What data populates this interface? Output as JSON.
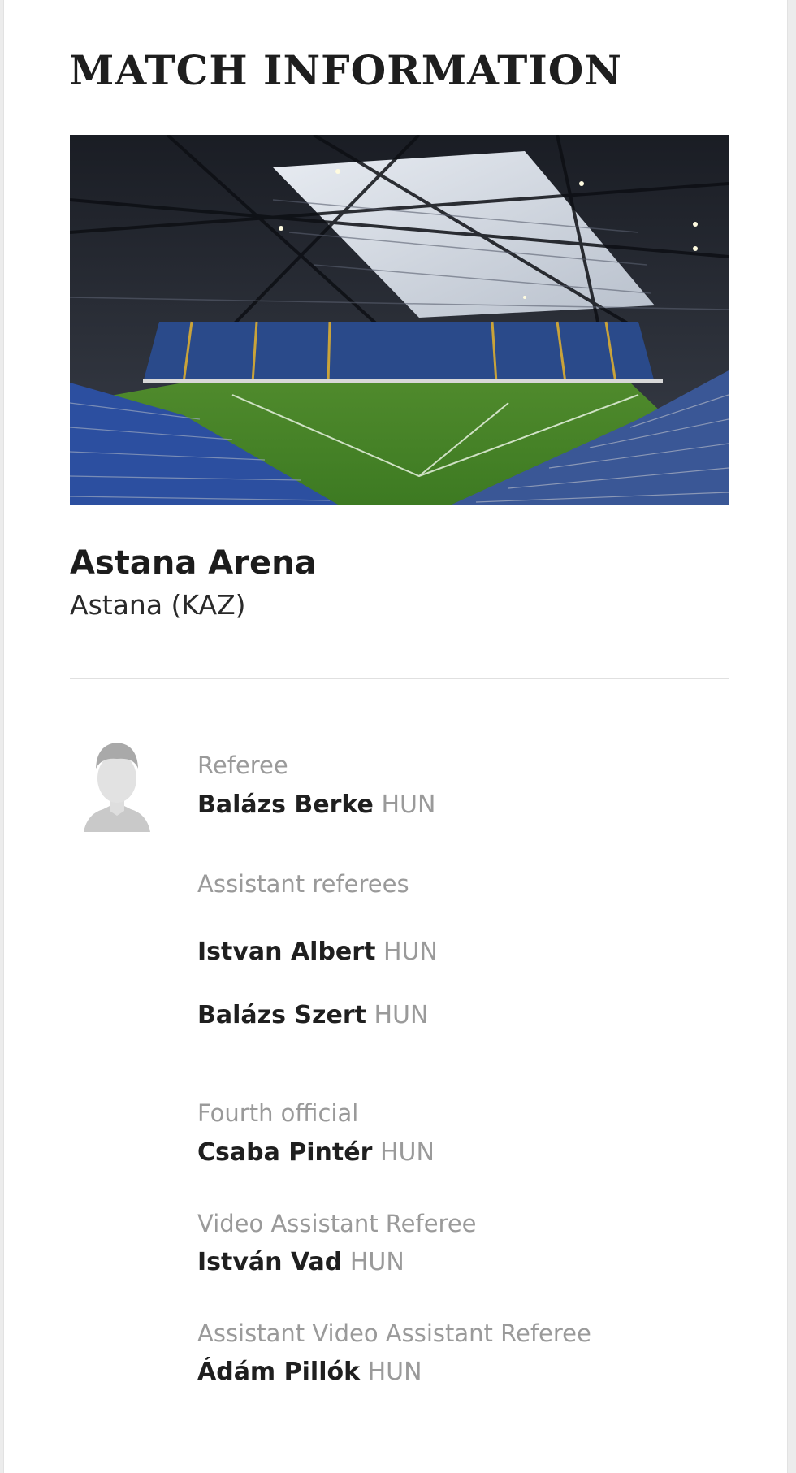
{
  "section": {
    "title": "MATCH INFORMATION"
  },
  "venue": {
    "name": "Astana Arena",
    "city": "Astana (KAZ)"
  },
  "officials": {
    "referee": {
      "role": "Referee",
      "name": "Balázs Berke",
      "nat": "HUN"
    },
    "assistants": {
      "role": "Assistant referees",
      "people": [
        {
          "name": "Istvan Albert",
          "nat": "HUN"
        },
        {
          "name": "Balázs Szert",
          "nat": "HUN"
        }
      ]
    },
    "fourth": {
      "role": "Fourth official",
      "name": "Csaba Pintér",
      "nat": "HUN"
    },
    "var": {
      "role": "Video Assistant Referee",
      "name": "István Vad",
      "nat": "HUN"
    },
    "avar": {
      "role": "Assistant Video Assistant Referee",
      "name": "Ádám Pillók",
      "nat": "HUN"
    }
  },
  "icons": {
    "avatar": "referee-avatar-icon"
  }
}
